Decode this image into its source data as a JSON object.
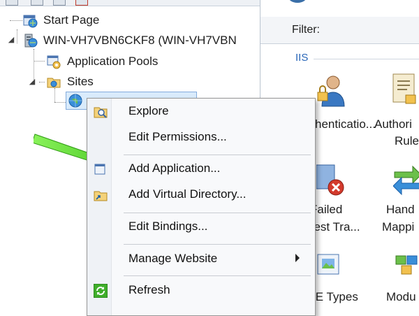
{
  "tree": {
    "items": [
      {
        "label": "Start Page",
        "icon": "start-page-icon"
      },
      {
        "label": "WIN-VH7VBN6CKF8 (WIN-VH7VBN",
        "icon": "server-icon"
      },
      {
        "label": "Application Pools",
        "icon": "application-pools-icon"
      },
      {
        "label": "Sites",
        "icon": "sites-folder-icon"
      },
      {
        "label": "",
        "icon": "website-globe-icon"
      }
    ]
  },
  "right_pane": {
    "filter_label": "Filter:",
    "section_label": "IIS",
    "features": [
      {
        "line1": "henticatio...",
        "icon": "authentication-icon"
      },
      {
        "line1": "Authori",
        "line2": "Rule",
        "icon": "authorization-rules-icon"
      },
      {
        "line1": "Failed",
        "line2": "uest Tra...",
        "icon": "failed-request-tracing-icon"
      },
      {
        "line1": "Hand",
        "line2": "Mappi",
        "icon": "handler-mappings-icon"
      },
      {
        "line1": "IE Types",
        "icon": "mime-types-icon"
      },
      {
        "line1": "Modu",
        "icon": "modules-icon"
      }
    ]
  },
  "context_menu": {
    "items": [
      {
        "label": "Explore",
        "icon": "explore-icon"
      },
      {
        "label": "Edit Permissions..."
      },
      {
        "label": "Add Application...",
        "icon": "add-application-icon"
      },
      {
        "label": "Add Virtual Directory...",
        "icon": "add-virtual-directory-icon"
      },
      {
        "label": "Edit Bindings..."
      },
      {
        "label": "Manage Website",
        "has_submenu": true
      },
      {
        "label": "Refresh",
        "icon": "refresh-icon"
      }
    ]
  },
  "colors": {
    "selection_fill": "#d9ebfb",
    "selection_border": "#84acdd",
    "section_header": "#2a67b8",
    "annotation_arrow": "#4fd62a"
  }
}
